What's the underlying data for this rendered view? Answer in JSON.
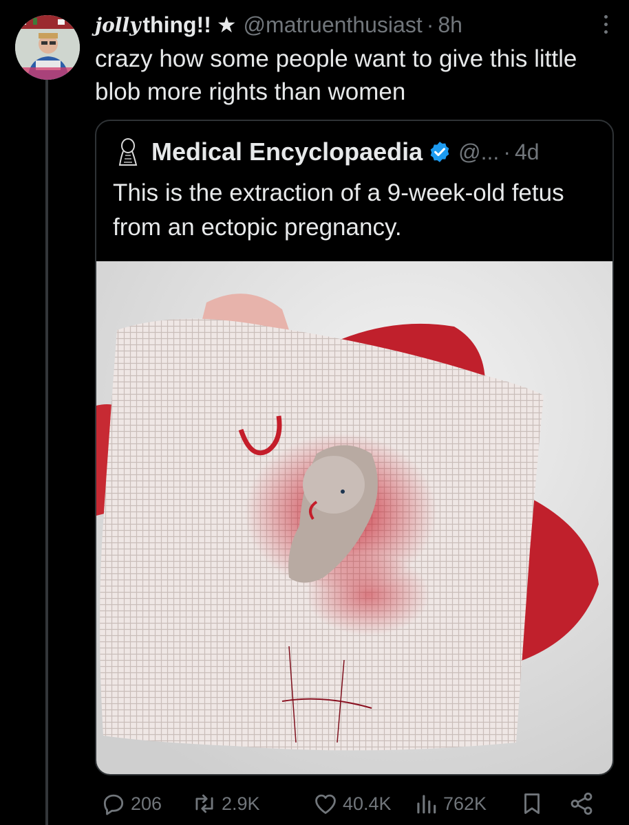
{
  "tweet": {
    "display_name_script": "jolly",
    "display_name": "thing!!",
    "star": "★",
    "handle": "@matruenthusiast",
    "separator": "·",
    "time": "8h",
    "text": "crazy how some people want to give this little blob more rights than women"
  },
  "quoted": {
    "name": "Medical Encyclopaedia",
    "handle": "@...",
    "separator": "·",
    "time": "4d",
    "text": "This is the extraction of a 9-week-old fetus from an ectopic pregnancy."
  },
  "actions": {
    "replies": "206",
    "retweets": "2.9K",
    "likes": "40.4K",
    "views": "762K"
  },
  "icons": {
    "more": "more-vertical-icon",
    "verified": "verified-badge-icon",
    "reply": "reply-icon",
    "retweet": "retweet-icon",
    "like": "heart-icon",
    "views": "views-chart-icon",
    "bookmark": "bookmark-icon",
    "share": "share-icon"
  },
  "colors": {
    "background": "#000000",
    "text": "#e7e9ea",
    "muted": "#71767b",
    "verified": "#1d9bf0",
    "border": "#2f3336"
  }
}
